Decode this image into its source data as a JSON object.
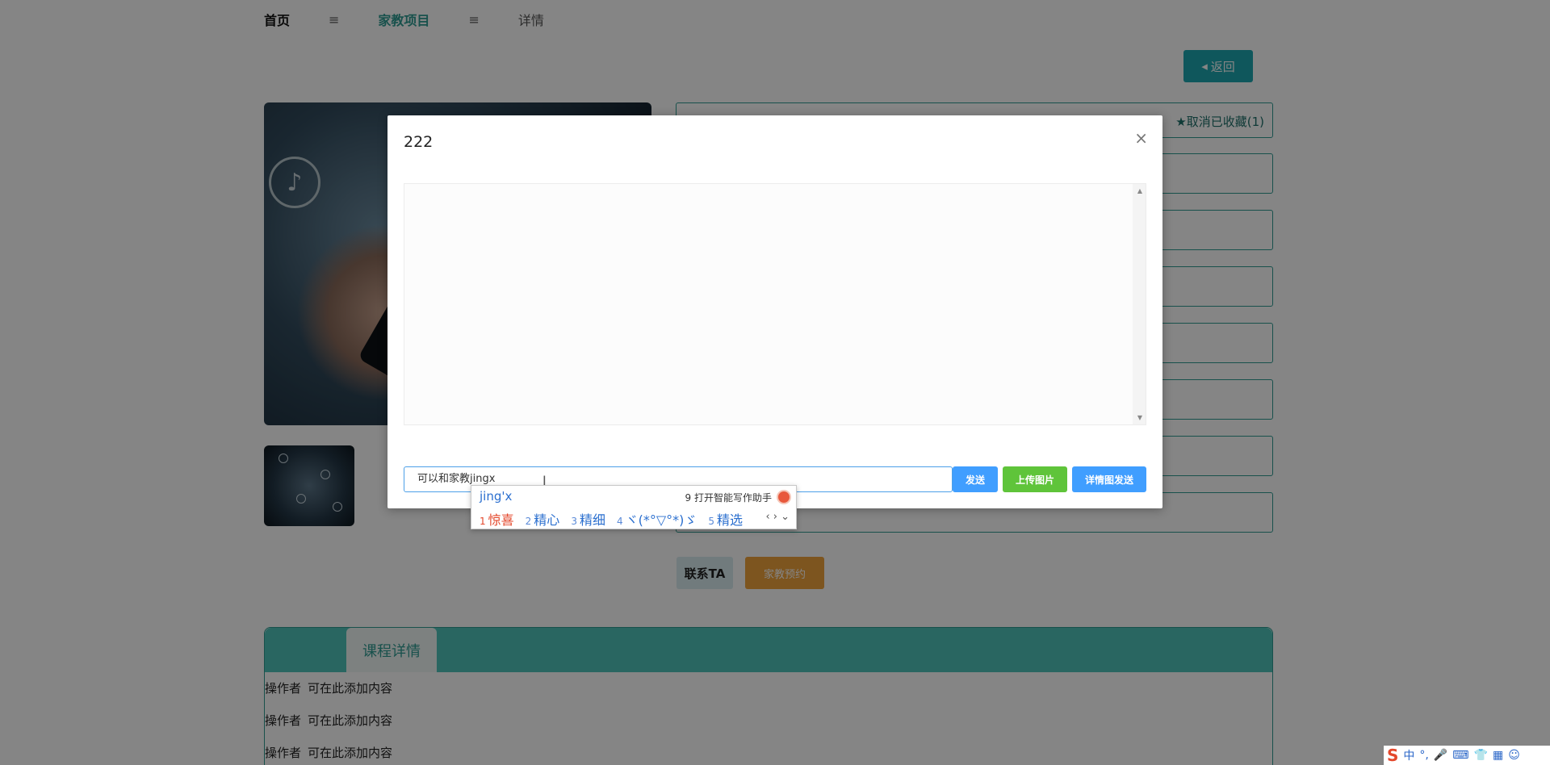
{
  "breadcrumb": {
    "home": "首页",
    "separator": "≡",
    "section": "家教项目",
    "current": "详情"
  },
  "back_button": "返回",
  "favorite": {
    "label": "取消已收藏(1)"
  },
  "actions": {
    "contact": "联系TA",
    "book": "家教预约"
  },
  "tabs": {
    "course_detail": "课程详情"
  },
  "detail_lines": [
    {
      "operator": "操作者",
      "content": "可在此添加内容"
    },
    {
      "operator": "操作者",
      "content": "可在此添加内容"
    },
    {
      "operator": "操作者",
      "content": "可在此添加内容"
    }
  ],
  "modal": {
    "title": "222",
    "close": "×",
    "input_value": "可以和家教jingx",
    "send": "发送",
    "upload_image": "上传图片",
    "detail_send": "详情图发送"
  },
  "ime": {
    "pinyin": "jing'x",
    "assist_num": "9",
    "assist_label": "打开智能写作助手",
    "candidates": [
      {
        "num": "1",
        "text": "惊喜"
      },
      {
        "num": "2",
        "text": "精心"
      },
      {
        "num": "3",
        "text": "精细"
      },
      {
        "num": "4",
        "text": "ヾ(*°▽°*)ゞ"
      },
      {
        "num": "5",
        "text": "精选"
      }
    ],
    "nav": "‹ › ⌄"
  },
  "tray": {
    "ime_lang": "中",
    "punct": "°,"
  },
  "colors": {
    "teal": "#2f9b93",
    "primary": "#409eff",
    "green": "#5fc43a",
    "orange": "#f0a33c",
    "back": "#1ea8b0"
  }
}
